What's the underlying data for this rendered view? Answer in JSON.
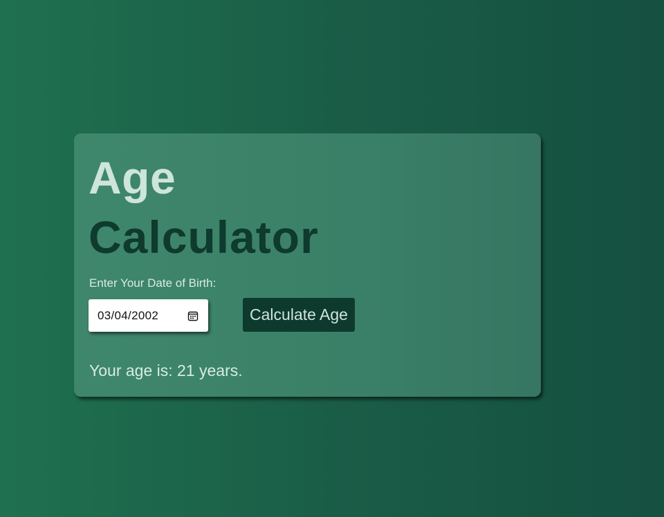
{
  "card": {
    "title_line1": "Age",
    "title_line2": "Calculator",
    "dob_label": "Enter Your Date of Birth:",
    "dob_value": "03/04/2002",
    "button_label": "Calculate Age",
    "result_text": "Your age is: 21 years."
  },
  "icons": {
    "calendar": "calendar-icon"
  },
  "colors": {
    "background": "#1a5d47",
    "card": "#3a8068",
    "title_light": "#cde5dc",
    "title_dark": "#0f3a2e",
    "button_bg": "#0e3a2e",
    "button_text": "#cfe4dc"
  }
}
